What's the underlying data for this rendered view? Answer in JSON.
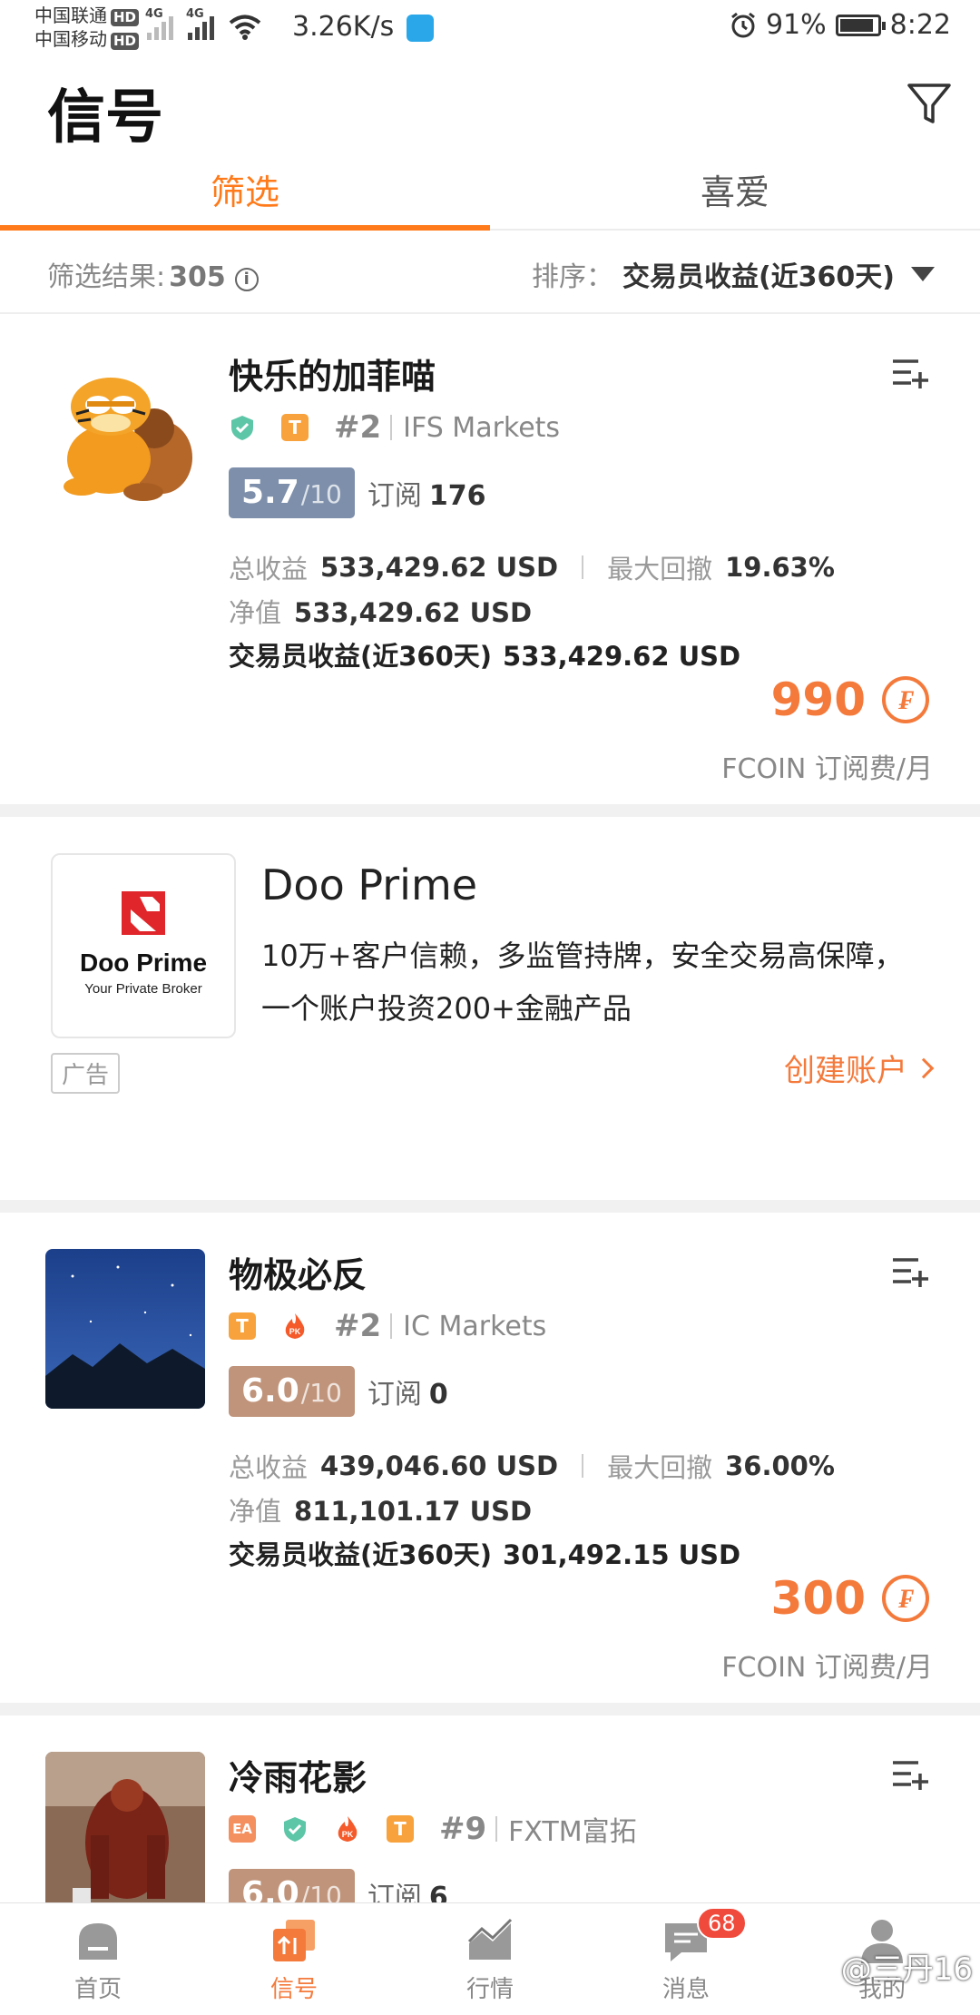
{
  "status_bar": {
    "carrier1": "中国联通",
    "carrier2": "中国移动",
    "hd": "HD",
    "net1": "4G",
    "net2": "4G",
    "speed": "3.26K/s",
    "battery": "91%",
    "time": "8:22"
  },
  "header": {
    "title": "信号"
  },
  "tabs": [
    {
      "label": "筛选"
    },
    {
      "label": "喜爱"
    }
  ],
  "filter": {
    "result_label": "筛选结果:",
    "result_count": "305",
    "sort_label": "排序：",
    "sort_value": "交易员收益(近360天)"
  },
  "cards": [
    {
      "name": "快乐的加菲喵",
      "badge_t": "T",
      "rank": "#2",
      "broker": "IFS Markets",
      "score": "5.7",
      "score_den": "/10",
      "score_color": "#7d8fab",
      "subs_label": "订阅",
      "subs": "176",
      "total_label": "总收益",
      "total": "533,429.62 USD",
      "drawdown_label": "最大回撤",
      "drawdown": "19.63%",
      "equity_label": "净值",
      "equity": "533,429.62 USD",
      "trader_label": "交易员收益(近360天)",
      "trader": "533,429.62 USD",
      "price": "990",
      "coin": "₣",
      "unit": "FCOIN 订阅费/月"
    },
    {
      "name": "物极必反",
      "badge_t": "T",
      "badge_pk": "PK",
      "rank": "#2",
      "broker": "IC Markets",
      "score": "6.0",
      "score_den": "/10",
      "score_color": "#c0947a",
      "subs_label": "订阅",
      "subs": "0",
      "total_label": "总收益",
      "total": "439,046.60 USD",
      "drawdown_label": "最大回撤",
      "drawdown": "36.00%",
      "equity_label": "净值",
      "equity": "811,101.17 USD",
      "trader_label": "交易员收益(近360天)",
      "trader": "301,492.15 USD",
      "price": "300",
      "coin": "₣",
      "unit": "FCOIN 订阅费/月"
    },
    {
      "name": "冷雨花影",
      "badge_ea": "EA",
      "badge_pk": "PK",
      "badge_t": "T",
      "rank": "#9",
      "broker": "FXTM富拓",
      "score": "6.0",
      "score_den": "/10",
      "score_color": "#c0947a",
      "subs_label": "订阅",
      "subs": "6"
    }
  ],
  "ad": {
    "title": "Doo Prime",
    "logo_name": "Doo Prime",
    "logo_sub": "Your Private Broker",
    "desc": "10万+客户信赖，多监管持牌，安全交易高保障，一个账户投资200+金融产品",
    "tag": "广告",
    "cta": "创建账户"
  },
  "bottom_nav": [
    {
      "label": "首页",
      "icon": "home-icon"
    },
    {
      "label": "信号",
      "icon": "signal-icon"
    },
    {
      "label": "行情",
      "icon": "chart-icon"
    },
    {
      "label": "消息",
      "icon": "message-icon",
      "badge": "68"
    },
    {
      "label": "我的",
      "icon": "profile-icon"
    }
  ],
  "watermark": "@三丹16",
  "colors": {
    "accent": "#ff7a1a",
    "price": "#f47a3c",
    "badge_t": "#f7a23c",
    "shield": "#5cc6a7"
  }
}
